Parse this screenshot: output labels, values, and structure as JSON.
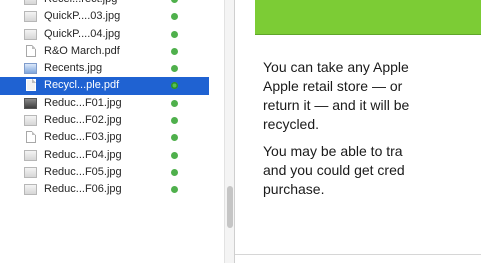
{
  "files": [
    {
      "name": "Recei...rect.jpg",
      "type": "jpg"
    },
    {
      "name": "QuickP....03.jpg",
      "type": "jpg"
    },
    {
      "name": "QuickP....04.jpg",
      "type": "jpg"
    },
    {
      "name": "R&O March.pdf",
      "type": "pdf"
    },
    {
      "name": "Recents.jpg",
      "type": "blue"
    },
    {
      "name": "Recycl...ple.pdf",
      "type": "pdf",
      "selected": true
    },
    {
      "name": "Reduc...F01.jpg",
      "type": "dark"
    },
    {
      "name": "Reduc...F02.jpg",
      "type": "jpg"
    },
    {
      "name": "Reduc...F03.jpg",
      "type": "pdf"
    },
    {
      "name": "Reduc...F04.jpg",
      "type": "jpg"
    },
    {
      "name": "Reduc...F05.jpg",
      "type": "jpg"
    },
    {
      "name": "Reduc...F06.jpg",
      "type": "jpg"
    }
  ],
  "preview": {
    "paragraph1": [
      "You can take any Apple",
      "Apple retail store — or",
      "return it — and it will be",
      "recycled."
    ],
    "paragraph2": [
      "You may be able to tra",
      "and you could get cred",
      "purchase."
    ]
  },
  "colors": {
    "selection": "#1f62d2",
    "tag_dot": "#4fb04c",
    "banner": "#7ccc35"
  }
}
